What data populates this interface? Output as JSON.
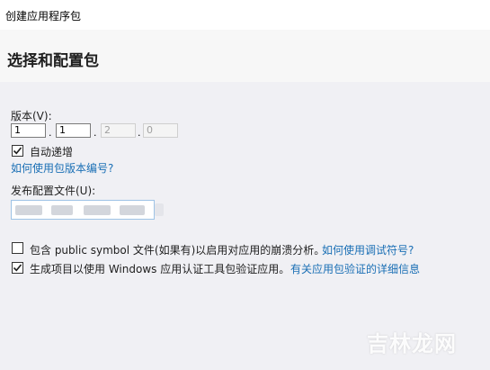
{
  "window": {
    "title": "创建应用程序包"
  },
  "header": {
    "heading": "选择和配置包"
  },
  "version": {
    "label": "版本(V):",
    "fields": [
      "1",
      "1",
      "2",
      "0"
    ],
    "separator": ".",
    "auto_increment": {
      "label": "自动递增",
      "checked": true
    },
    "help_link": "如何使用包版本编号?"
  },
  "publish_profile": {
    "label": "发布配置文件(U):",
    "value": ""
  },
  "options": {
    "public_symbol": {
      "label": "包含 public symbol 文件(如果有)以启用对应用的崩溃分析。",
      "checked": false,
      "link": "如何使用调试符号?"
    },
    "wack": {
      "label": "生成项目以使用 Windows 应用认证工具包验证应用。",
      "checked": true,
      "link": "有关应用包验证的详细信息"
    }
  },
  "watermark": "吉林龙网",
  "colors": {
    "link": "#1a6fb5",
    "header_bg": "#f7f7f7",
    "content_bg": "#f0f0f4"
  }
}
